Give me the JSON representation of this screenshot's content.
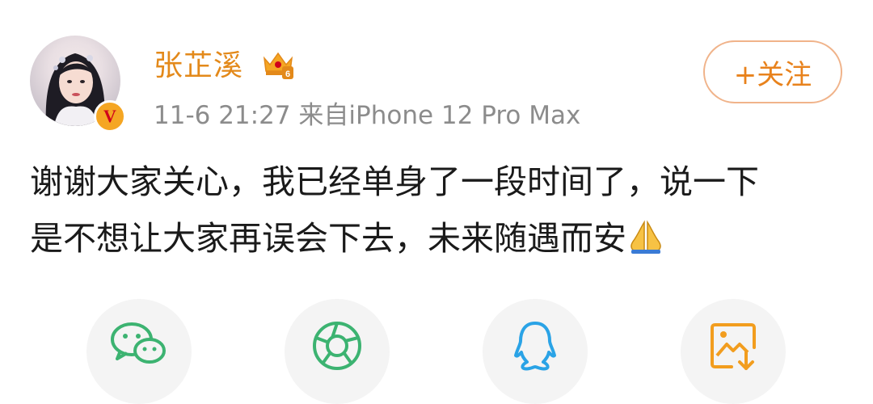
{
  "post": {
    "author": "张芷溪",
    "meta": "11-6 21:27  来自iPhone 12 Pro Max",
    "follow_label": "+关注",
    "text_line1": "谢谢大家关心，我已经单身了一段时间了，说一下",
    "text_line2": "是不想让大家再误会下去，未来随遇而安",
    "emoji": "pray-emoji"
  },
  "share": {
    "items": [
      {
        "icon": "wechat-icon"
      },
      {
        "icon": "moments-icon"
      },
      {
        "icon": "qq-icon"
      },
      {
        "icon": "save-image-icon"
      }
    ]
  },
  "colors": {
    "username": "#e3891a",
    "meta": "#8c8c8c",
    "follow_border": "#f0b38a",
    "follow_text": "#e8821c",
    "wechat": "#3cb371",
    "qq": "#2aa3e6",
    "save": "#f29d1e"
  }
}
